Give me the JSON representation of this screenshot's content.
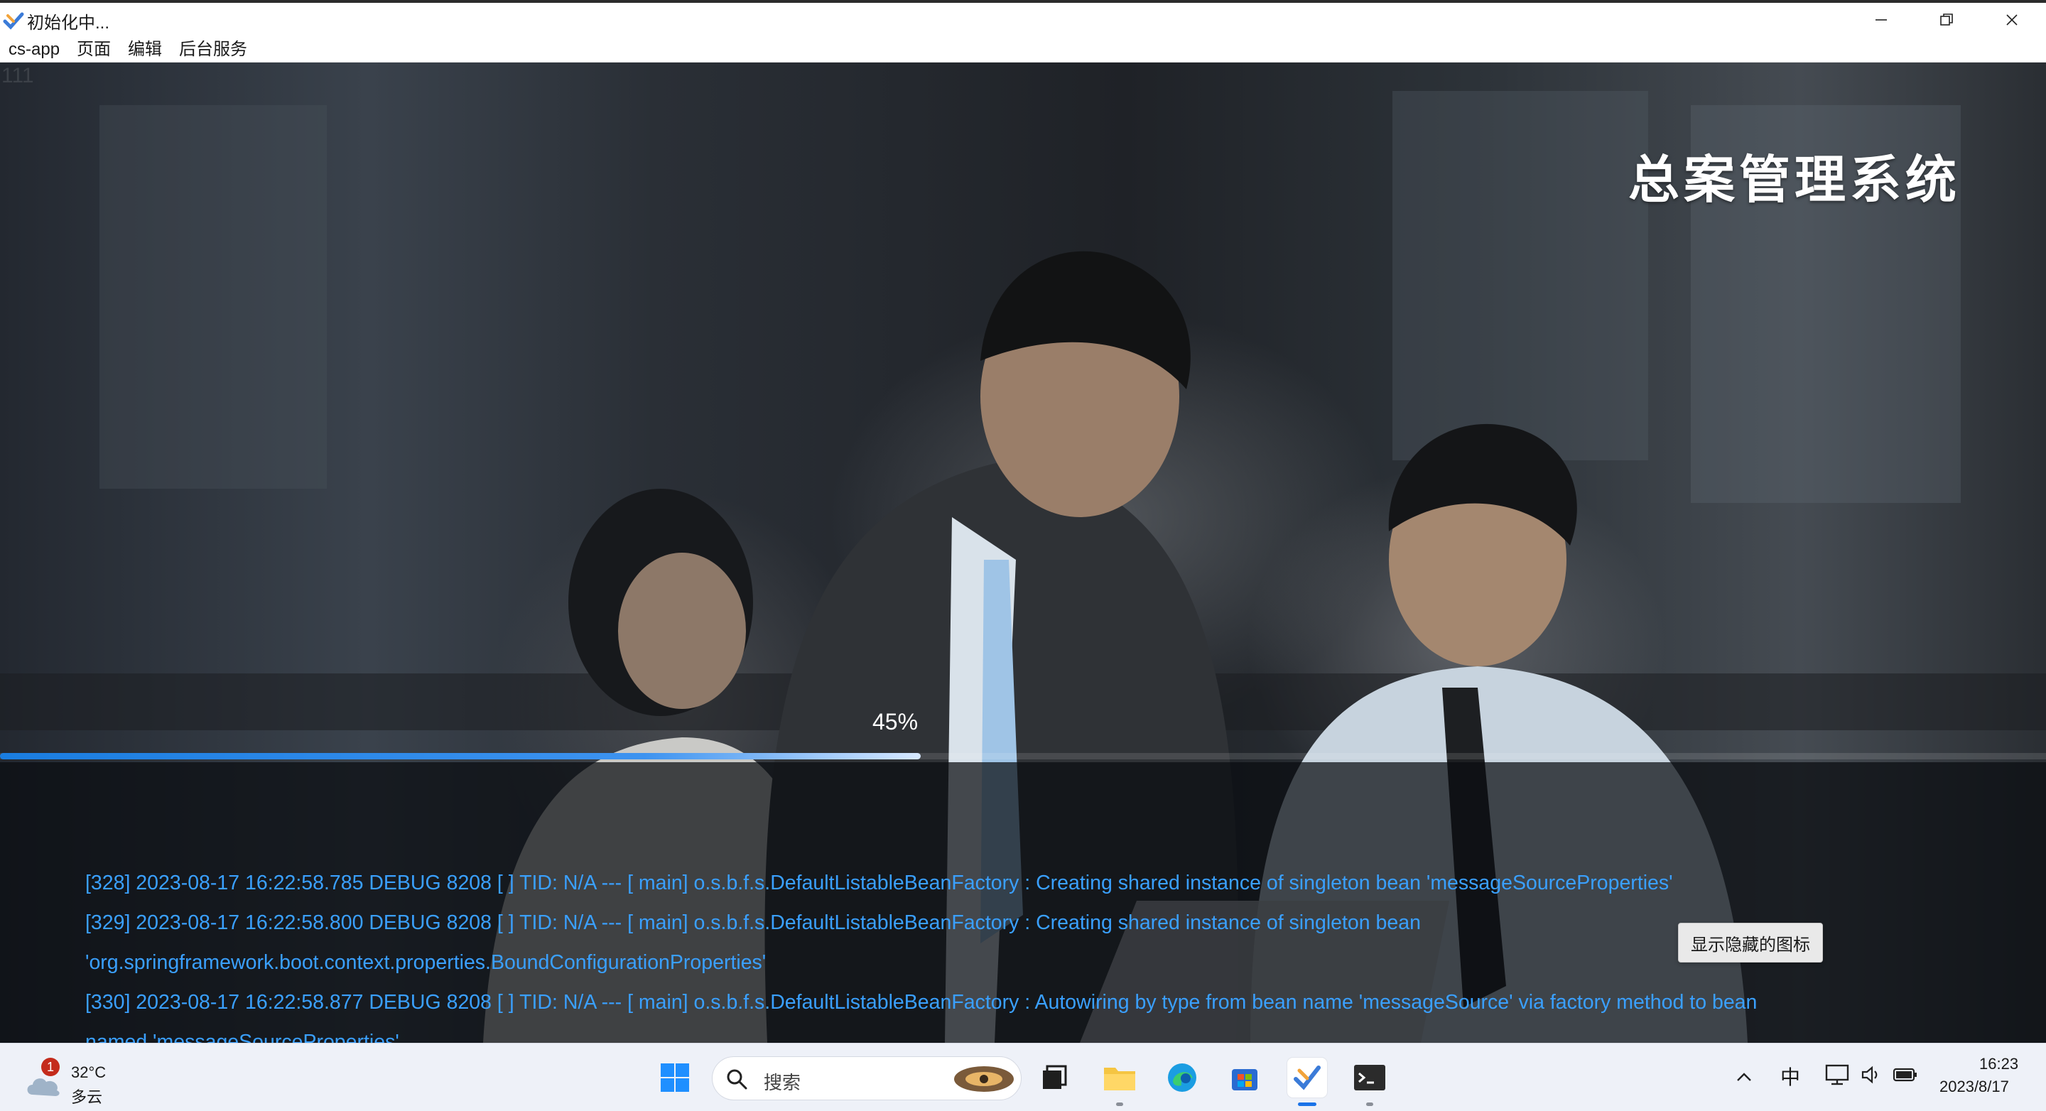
{
  "window": {
    "title": "初始化中...",
    "menu": [
      "cs-app",
      "页面",
      "编辑",
      "后台服务"
    ]
  },
  "splash": {
    "debug_label": "111",
    "system_title": "总案管理系统",
    "progress_text": "45%",
    "progress_fraction": 0.45,
    "log_lines": [
      "[328] 2023-08-17 16:22:58.785 DEBUG 8208 [              ] TID: N/A --- [ main] o.s.b.f.s.DefaultListableBeanFactory : Creating shared instance of singleton bean 'messageSourceProperties'",
      "[329] 2023-08-17 16:22:58.800 DEBUG 8208 [              ] TID: N/A --- [ main] o.s.b.f.s.DefaultListableBeanFactory : Creating shared instance of singleton bean",
      "'org.springframework.boot.context.properties.BoundConfigurationProperties'",
      "[330] 2023-08-17 16:22:58.877 DEBUG 8208 [              ] TID: N/A --- [ main] o.s.b.f.s.DefaultListableBeanFactory : Autowiring by type from bean name 'messageSource' via factory method to bean",
      "named 'messageSourceProperties'"
    ]
  },
  "tooltip": {
    "text": "显示隐藏的图标"
  },
  "taskbar": {
    "weather": {
      "temp": "32°C",
      "desc": "多云",
      "badge": "1"
    },
    "search_placeholder": "搜索",
    "ime": "中",
    "clock": {
      "time": "16:23",
      "date": "2023/8/17"
    }
  },
  "colors": {
    "accent": "#1a73e8",
    "log_text": "#3aa0ff",
    "progress": "#3d93f0"
  }
}
